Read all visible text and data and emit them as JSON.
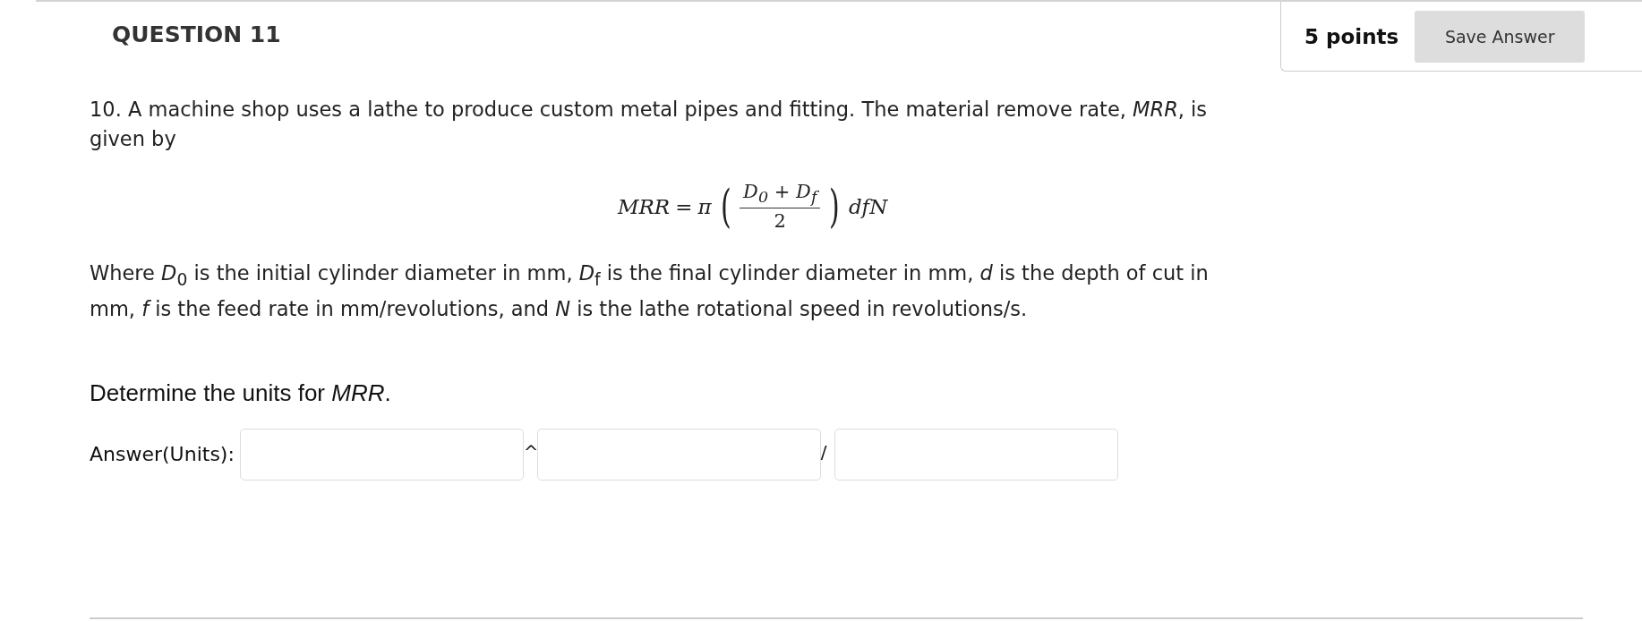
{
  "question": {
    "title": "QUESTION 11",
    "points": "5 points",
    "save_button": "Save Answer"
  },
  "intro": "10.  A machine shop uses a lathe to produce custom metal pipes and fitting. The material remove rate, *MRR*, is given by",
  "formula": {
    "lhs": "MRR",
    "equals": "=",
    "pi": "π",
    "open": "(",
    "numerator": "D$_{0}$ + D$_{f}$",
    "denominator": "2",
    "close": ")",
    "tail": "dfN"
  },
  "definitions": "Where *D*$_{0}$ is the initial cylinder diameter in mm, *D*$_{f}$ is the final cylinder diameter in mm, *d* is the depth of cut in mm, *f* is the feed rate in mm/revolutions, and *N* is the lathe rotational speed in revolutions/s.",
  "prompt": "Determine the units for *MRR*.",
  "answer": {
    "label": "Answer(Units):",
    "parts": [
      {
        "kind": "field"
      },
      {
        "kind": "operator",
        "text": "^"
      },
      {
        "kind": "field"
      },
      {
        "kind": "operator",
        "text": "/"
      },
      {
        "kind": "field"
      }
    ]
  }
}
